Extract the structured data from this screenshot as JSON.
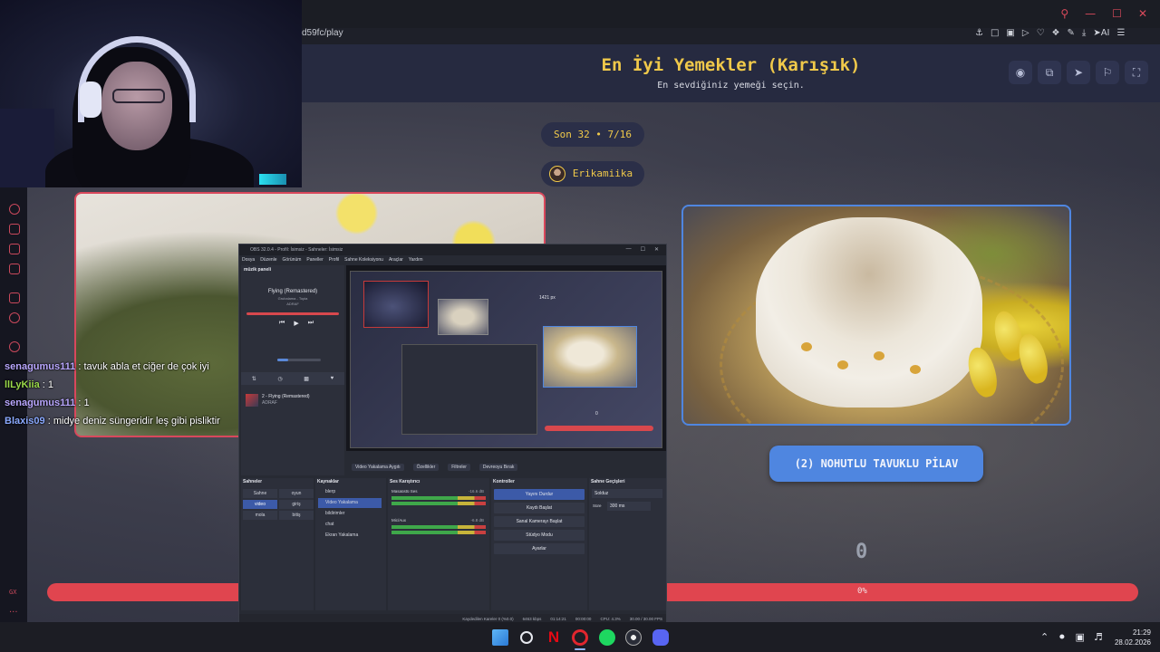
{
  "browser": {
    "url": "d59fc/play",
    "toolbar_icons": [
      "pin-icon",
      "snapshot-icon",
      "screenshot-icon",
      "play-icon",
      "heart-icon",
      "extensions-icon",
      "download-icon",
      "ai-icon",
      "menu-icon"
    ],
    "ai_label": "AI"
  },
  "game": {
    "title": "En İyi Yemekler (Karışık)",
    "subtitle": "En sevdiğiniz yemeği seçin.",
    "round": "Son 32 • 7/16",
    "username": "Erikamiika",
    "choice_right_label": "(2) NOHUTLU TAVUKLU PİLAV",
    "vote_count": "0",
    "progress_label": "0%",
    "progress_value": 0,
    "header_buttons": [
      "eye-icon",
      "share-icon",
      "send-icon",
      "flag-icon",
      "fullscreen-icon"
    ]
  },
  "sidebar": {
    "label": "GX",
    "more": "..."
  },
  "chat": {
    "messages": [
      {
        "user": "senagumus111",
        "text": ": tavuk abla et ciğer de çok iyi",
        "color": "#b9a7ff"
      },
      {
        "user": "llLyKiia",
        "text": ": 1",
        "color": "#9ad94a"
      },
      {
        "user": "senagumus111",
        "text": ": 1",
        "color": "#b9a7ff"
      },
      {
        "user": "Blaxis09",
        "text": ": midye deniz süngeridir leş gibi pisliktir",
        "color": "#8aa9ff"
      }
    ]
  },
  "obs": {
    "title": "OBS 32.0.4 - Profil: İsimsiz - Sahneler: İsimsiz",
    "menu": [
      "Dosya",
      "Düzenle",
      "Görünüm",
      "Paneller",
      "Profil",
      "Sahne Koleksiyonu",
      "Araçlar",
      "Yardım"
    ],
    "music_dock_title": "müzik paneli",
    "song": "Flying (Remastered)",
    "artist": "Grubalama - Topia",
    "song_extra": "ADRAF",
    "queue_item": "2 - Flying (Remastered)",
    "queue_sub": "ADRAF",
    "preview_label": "1421 px",
    "preview_vote": "0",
    "source_bar": [
      "Video Yakalama Aygıtı",
      "Özellikler",
      "Filtreler",
      "Devreoyu Bırak"
    ],
    "panels": {
      "scenes_title": "Sahneler",
      "scenes": [
        [
          "Sahne",
          "oyun"
        ],
        [
          "video",
          "giriş"
        ],
        [
          "mola",
          "bitiş"
        ]
      ],
      "sources_title": "Kaynaklar",
      "sources": [
        "blerp",
        "Video Yakalama",
        "bildirimler",
        "chat",
        "Ekran Yakalama"
      ],
      "mixer_title": "Ses Karıştırıcı",
      "mixer": [
        {
          "name": "Masaüstü Ses",
          "db": "-16.6 dB"
        },
        {
          "name": "Mic/Aux",
          "db": "-6.8 dB"
        }
      ],
      "controls_title": "Kontroller",
      "controls": [
        "Yayını Durdur",
        "Kaydı Başlat",
        "Sanal Kamerayı Başlat",
        "Stüdyo Modu",
        "Ayarlar"
      ],
      "transitions_title": "Sahne Geçişleri",
      "transition": "Solduz",
      "duration_label": "Süre",
      "duration": "300 ms"
    },
    "status": [
      "Kaydedilen Kareler 0 (%0.0)",
      "6463 kbps",
      "01:14:21",
      "00:00:00",
      "CPU: 4.3%",
      "30.00 / 30.00 FPS"
    ]
  },
  "taskbar": {
    "apps": [
      "windows-icon",
      "search-icon",
      "netflix-icon",
      "opera-gx-icon",
      "spotify-icon",
      "steam-icon",
      "discord-icon"
    ],
    "netflix_glyph": "N",
    "time": "21:29",
    "date": "28.02.2026"
  }
}
